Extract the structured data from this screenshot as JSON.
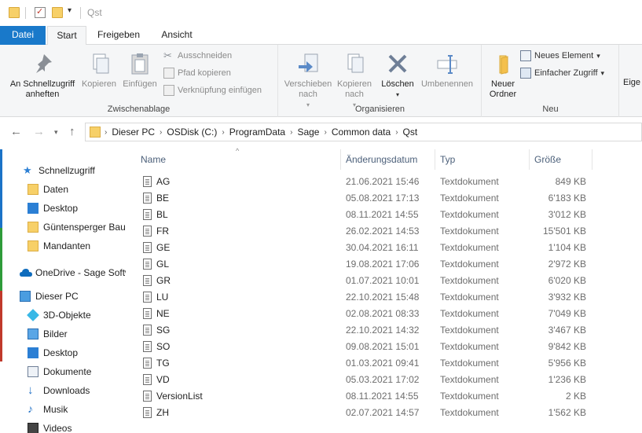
{
  "window": {
    "title": "Qst"
  },
  "ribbon_tabs": [
    {
      "label": "Datei"
    },
    {
      "label": "Start"
    },
    {
      "label": "Freigeben"
    },
    {
      "label": "Ansicht"
    }
  ],
  "ribbon": {
    "clipboard": {
      "pin_label": "An Schnellzugriff anheften",
      "copy_label": "Kopieren",
      "paste_label": "Einfügen",
      "cut_label": "Ausschneiden",
      "copy_path_label": "Pfad kopieren",
      "paste_shortcut_label": "Verknüpfung einfügen",
      "group_label": "Zwischenablage"
    },
    "organize": {
      "move_label": "Verschieben nach",
      "copyto_label": "Kopieren nach",
      "delete_label": "Löschen",
      "rename_label": "Umbenennen",
      "group_label": "Organisieren"
    },
    "new": {
      "new_folder_label": "Neuer Ordner",
      "new_item_label": "Neues Element",
      "easy_access_label": "Einfacher Zugriff",
      "group_label": "Neu"
    },
    "open": {
      "partial_label": "Eige"
    }
  },
  "breadcrumb": [
    "Dieser PC",
    "OSDisk (C:)",
    "ProgramData",
    "Sage",
    "Common data",
    "Qst"
  ],
  "nav": {
    "quick_access": "Schnellzugriff",
    "quick_items": [
      "Daten",
      "Desktop",
      "Güntensperger Bau",
      "Mandanten"
    ],
    "onedrive": "OneDrive - Sage Softw",
    "this_pc": "Dieser PC",
    "pc_items": [
      "3D-Objekte",
      "Bilder",
      "Desktop",
      "Dokumente",
      "Downloads",
      "Musik",
      "Videos"
    ]
  },
  "columns": {
    "name": "Name",
    "date": "Änderungsdatum",
    "type": "Typ",
    "size": "Größe"
  },
  "files": [
    {
      "name": "AG",
      "date": "21.06.2021 15:46",
      "type": "Textdokument",
      "size": "849 KB"
    },
    {
      "name": "BE",
      "date": "05.08.2021 17:13",
      "type": "Textdokument",
      "size": "6'183 KB"
    },
    {
      "name": "BL",
      "date": "08.11.2021 14:55",
      "type": "Textdokument",
      "size": "3'012 KB"
    },
    {
      "name": "FR",
      "date": "26.02.2021 14:53",
      "type": "Textdokument",
      "size": "15'501 KB"
    },
    {
      "name": "GE",
      "date": "30.04.2021 16:11",
      "type": "Textdokument",
      "size": "1'104 KB"
    },
    {
      "name": "GL",
      "date": "19.08.2021 17:06",
      "type": "Textdokument",
      "size": "2'972 KB"
    },
    {
      "name": "GR",
      "date": "01.07.2021 10:01",
      "type": "Textdokument",
      "size": "6'020 KB"
    },
    {
      "name": "LU",
      "date": "22.10.2021 15:48",
      "type": "Textdokument",
      "size": "3'932 KB"
    },
    {
      "name": "NE",
      "date": "02.08.2021 08:33",
      "type": "Textdokument",
      "size": "7'049 KB"
    },
    {
      "name": "SG",
      "date": "22.10.2021 14:32",
      "type": "Textdokument",
      "size": "3'467 KB"
    },
    {
      "name": "SO",
      "date": "09.08.2021 15:01",
      "type": "Textdokument",
      "size": "9'842 KB"
    },
    {
      "name": "TG",
      "date": "01.03.2021 09:41",
      "type": "Textdokument",
      "size": "5'956 KB"
    },
    {
      "name": "VD",
      "date": "05.03.2021 17:02",
      "type": "Textdokument",
      "size": "1'236 KB"
    },
    {
      "name": "VersionList",
      "date": "08.11.2021 14:55",
      "type": "Textdokument",
      "size": "2 KB"
    },
    {
      "name": "ZH",
      "date": "02.07.2021 14:57",
      "type": "Textdokument",
      "size": "1'562 KB"
    }
  ]
}
